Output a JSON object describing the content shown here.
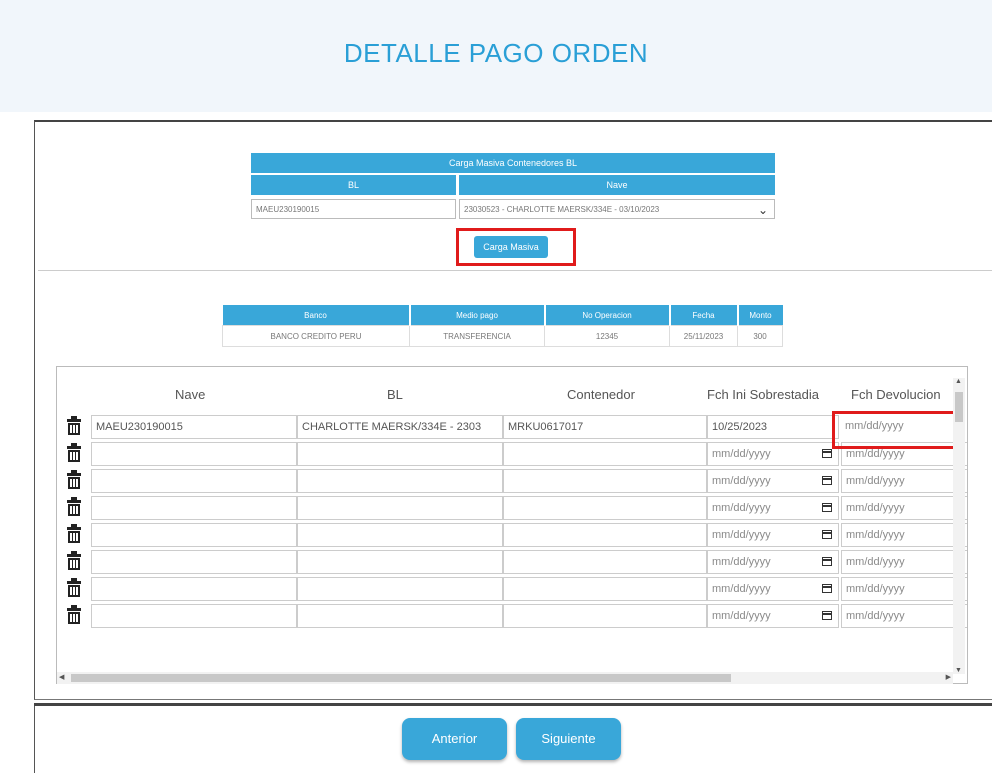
{
  "page": {
    "title": "DETALLE PAGO ORDEN"
  },
  "carga_masiva": {
    "header": "Carga Masiva Contenedores BL",
    "col_bl": "BL",
    "col_nave": "Nave",
    "bl_value": "MAEU230190015",
    "nave_value": "23030523 - CHARLOTTE MAERSK/334E - 03/10/2023",
    "button": "Carga Masiva"
  },
  "pago": {
    "headers": [
      "Banco",
      "Medio pago",
      "No Operacion",
      "Fecha",
      "Monto"
    ],
    "row": [
      "BANCO CREDITO PERU",
      "TRANSFERENCIA",
      "12345",
      "25/11/2023",
      "300"
    ]
  },
  "grid": {
    "headers": {
      "nave": "Nave",
      "bl": "BL",
      "contenedor": "Contenedor",
      "fch_ini": "Fch Ini Sobrestadia",
      "fch_dev": "Fch Devolucion"
    },
    "date_placeholder": "mm/dd/yyyy",
    "first_row": {
      "nave": "MAEU230190015",
      "bl": "CHARLOTTE MAERSK/334E - 2303",
      "contenedor": "MRKU0617017",
      "fch_ini": "10/25/2023"
    }
  },
  "buttons": {
    "prev": "Anterior",
    "next": "Siguiente"
  },
  "icons": [
    "trash-icon",
    "calendar-icon",
    "chevron-down-icon"
  ],
  "colors": {
    "accent": "#39a7d9",
    "title": "#2a9fd6",
    "highlight": "#e01b1b"
  }
}
